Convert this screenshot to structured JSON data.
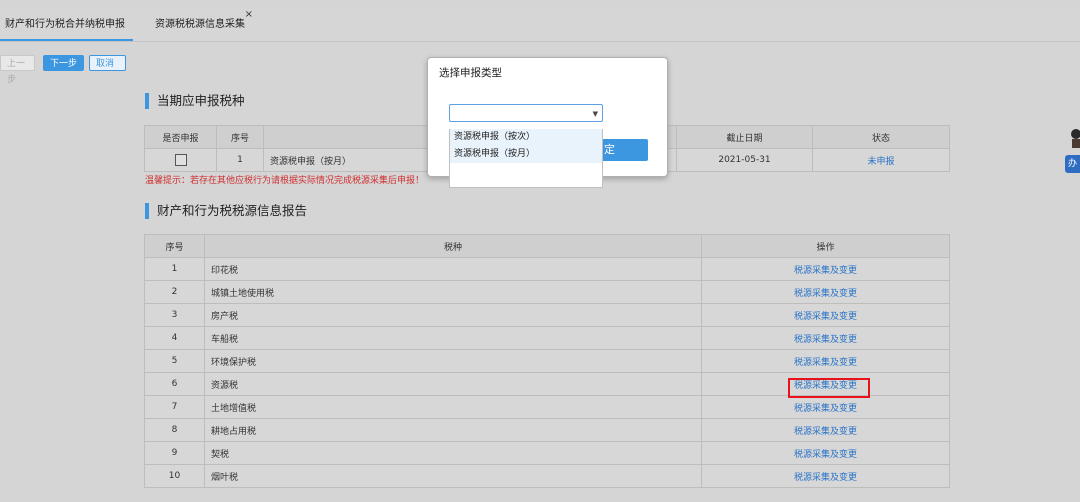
{
  "tabs": [
    {
      "label": "财产和行为税合并纳税申报"
    },
    {
      "label": "资源税税源信息采集",
      "close": "×"
    }
  ],
  "toolbar": {
    "prev": "上一步",
    "next": "下一步",
    "cancel": "取消"
  },
  "section1": {
    "title": "当期应申报税种",
    "headers": [
      "是否申报",
      "序号",
      "",
      "截止日期",
      "状态"
    ],
    "row": {
      "index": "1",
      "name": "资源税申报（按月）",
      "deadline": "2021-05-31",
      "status": "未申报"
    },
    "hint": "温馨提示：若存在其他应税行为请根据实际情况完成税源采集后申报！"
  },
  "section2": {
    "title": "财产和行为税税源信息报告",
    "headers": [
      "序号",
      "税种",
      "操作"
    ],
    "rows": [
      {
        "index": "1",
        "name": "印花税",
        "action": "税源采集及变更"
      },
      {
        "index": "2",
        "name": "城镇土地使用税",
        "action": "税源采集及变更"
      },
      {
        "index": "3",
        "name": "房产税",
        "action": "税源采集及变更"
      },
      {
        "index": "4",
        "name": "车船税",
        "action": "税源采集及变更"
      },
      {
        "index": "5",
        "name": "环境保护税",
        "action": "税源采集及变更"
      },
      {
        "index": "6",
        "name": "资源税",
        "action": "税源采集及变更"
      },
      {
        "index": "7",
        "name": "土地增值税",
        "action": "税源采集及变更"
      },
      {
        "index": "8",
        "name": "耕地占用税",
        "action": "税源采集及变更"
      },
      {
        "index": "9",
        "name": "契税",
        "action": "税源采集及变更"
      },
      {
        "index": "10",
        "name": "烟叶税",
        "action": "税源采集及变更"
      }
    ]
  },
  "dialog": {
    "title": "选择申报类型",
    "select_value": "",
    "options": [
      "资源税申报（按次）",
      "资源税申报（按月）"
    ],
    "confirm_tail": "定"
  },
  "side": {
    "badge": "办"
  }
}
